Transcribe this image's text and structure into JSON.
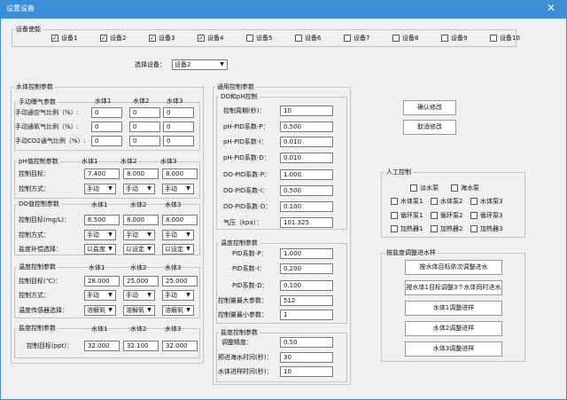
{
  "window": {
    "title": "设置设备",
    "close_glyph": "✕"
  },
  "enable": {
    "label": "设备使能",
    "devices": [
      {
        "label": "设备1",
        "checked": true
      },
      {
        "label": "设备2",
        "checked": true
      },
      {
        "label": "设备3",
        "checked": true
      },
      {
        "label": "设备4",
        "checked": true
      },
      {
        "label": "设备5",
        "checked": false
      },
      {
        "label": "设备6",
        "checked": false
      },
      {
        "label": "设备7",
        "checked": false
      },
      {
        "label": "设备8",
        "checked": false
      },
      {
        "label": "设备9",
        "checked": false
      },
      {
        "label": "设备10",
        "checked": false
      }
    ]
  },
  "select": {
    "label": "选择设备：",
    "value": "设备2"
  },
  "water": {
    "label": "水体控制参数",
    "aeration": {
      "label": "手动曝气参数",
      "cols": [
        "水体1",
        "水体2",
        "水体3"
      ],
      "rows": [
        {
          "label": "手动通空气比例（%）:",
          "values": [
            "0",
            "0",
            "0"
          ]
        },
        {
          "label": "手动通氧气比例（%）:",
          "values": [
            "0",
            "0",
            "0"
          ]
        },
        {
          "label": "手动CO2通气比例（%）:",
          "values": [
            "0",
            "0",
            "0"
          ]
        }
      ]
    },
    "ph": {
      "label": "pH值控制参数",
      "cols": [
        "水体1",
        "水体2",
        "水体3"
      ],
      "target_label": "控制目标：",
      "targets": [
        "7.400",
        "8.000",
        "8.000"
      ],
      "mode_label": "控制方式：",
      "modes": [
        "手动",
        "手动",
        "手动"
      ]
    },
    "do": {
      "label": "DO值控制参数",
      "cols": [
        "水体1",
        "水体2",
        "水体3"
      ],
      "target_label": "控制目标(mg/L)：",
      "targets": [
        "6.500",
        "8.000",
        "8.000"
      ],
      "mode_label": "控制方式：",
      "modes": [
        "手动",
        "手动",
        "手动"
      ],
      "comp_label": "盐度补偿选择：",
      "comps": [
        "以盐度",
        "以设定",
        "以设定"
      ]
    },
    "temp": {
      "label": "温度控制参数",
      "cols": [
        "水体1",
        "水体2",
        "水体3"
      ],
      "target_label": "控制目标(℃)：",
      "targets": [
        "28.000",
        "25.000",
        "25.000"
      ],
      "mode_label": "控制方式：",
      "modes": [
        "手动",
        "手动",
        "手动"
      ],
      "sensor_label": "温度传感器选择：",
      "sensors": [
        "溶解氧",
        "溶解氧",
        "溶解氧"
      ]
    },
    "salinity": {
      "label": "盐度控制参数",
      "cols": [
        "水体1",
        "水体2",
        "水体3"
      ],
      "target_label": "控制目标(ppt)：",
      "targets": [
        "32.000",
        "32.100",
        "32.000"
      ]
    }
  },
  "general": {
    "label": "通用控制参数",
    "doph": {
      "label": "DO和pH控制",
      "rows": [
        {
          "label": "控制周期(秒)：",
          "value": "10"
        },
        {
          "label": "pH-PID系数-P：",
          "value": "0.500"
        },
        {
          "label": "pH-PID系数-I：",
          "value": "0.010"
        },
        {
          "label": "pH-PID系数-D：",
          "value": "0.010"
        },
        {
          "label": "DO-PID系数-P：",
          "value": "1.000"
        },
        {
          "label": "DO-PID系数-I：",
          "value": "0.500"
        },
        {
          "label": "DO-PID系数-D：",
          "value": "0.100"
        },
        {
          "label": "气压（kpa）：",
          "value": "101.325"
        }
      ]
    },
    "temp": {
      "label": "温度控制参数",
      "rows": [
        {
          "label": "PID系数-P：",
          "value": "1.000"
        },
        {
          "label": "PID系数-I：",
          "value": "0.200"
        },
        {
          "label": "PID系数-D：",
          "value": "0.100"
        },
        {
          "label": "控制量最大参数：",
          "value": "512"
        },
        {
          "label": "控制量最小参数：",
          "value": "1"
        }
      ]
    },
    "salinity": {
      "label": "盐度控制参数",
      "rows": [
        {
          "label": "调整精度：",
          "value": "0.50"
        },
        {
          "label": "预进海水时间(秒)：",
          "value": "30"
        },
        {
          "label": "水体进样时间(秒)：",
          "value": "10"
        }
      ]
    }
  },
  "actions": {
    "confirm": "确认修改",
    "cancel": "取消修改"
  },
  "manual": {
    "label": "人工控制",
    "items": [
      {
        "label": "淡水泵"
      },
      {
        "label": "海水泵"
      },
      {
        "label": "水体泵1"
      },
      {
        "label": "水体泵2"
      },
      {
        "label": "水体泵3"
      },
      {
        "label": "循环泵1"
      },
      {
        "label": "循环泵2"
      },
      {
        "label": "循环泵3"
      },
      {
        "label": "加热器1"
      },
      {
        "label": "加热器2"
      },
      {
        "label": "加热器3"
      }
    ]
  },
  "sal_adjust": {
    "label": "按盐度调整进水样",
    "buttons": [
      "按水体目标依次调整进水",
      "按水体1目标调整3个水体同时进水",
      "水体1调整进样",
      "水体2调整进样",
      "水体3调整进样"
    ]
  }
}
